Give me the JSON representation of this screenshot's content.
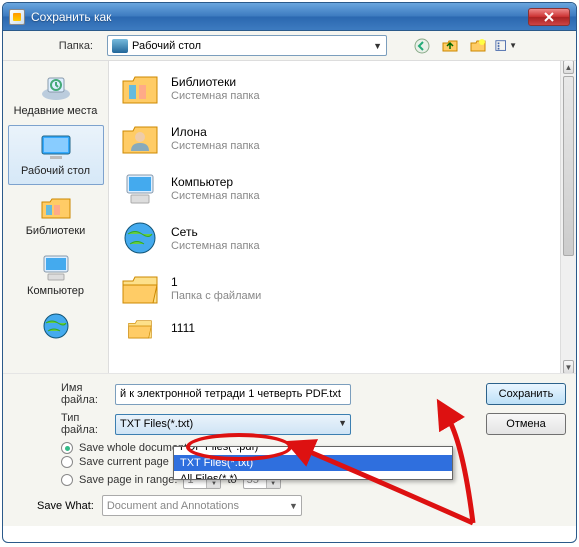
{
  "window": {
    "title": "Сохранить как"
  },
  "toolbar": {
    "folder_label": "Папка:",
    "folder_value": "Рабочий стол"
  },
  "places": [
    {
      "label": "Недавние места",
      "selected": false
    },
    {
      "label": "Рабочий стол",
      "selected": true
    },
    {
      "label": "Библиотеки",
      "selected": false
    },
    {
      "label": "Компьютер",
      "selected": false
    },
    {
      "label": "",
      "selected": false
    }
  ],
  "files": [
    {
      "name": "Библиотеки",
      "type": "Системная папка"
    },
    {
      "name": "Илона",
      "type": "Системная папка"
    },
    {
      "name": "Компьютер",
      "type": "Системная папка"
    },
    {
      "name": "Сеть",
      "type": "Системная папка"
    },
    {
      "name": "1",
      "type": "Папка с файлами"
    },
    {
      "name": "1111",
      "type": ""
    }
  ],
  "form": {
    "filename_label": "Имя файла:",
    "filename_value": "й к электронной тетради 1 четверть PDF.txt",
    "filetype_label": "Тип файла:",
    "filetype_value": "TXT Files(*.txt)",
    "save_label": "Сохранить",
    "cancel_label": "Отмена"
  },
  "dropdown": {
    "item_above": "PDF Files(*.pdf)",
    "item_selected": "TXT Files(*.txt)",
    "item_below": "All Files(*.*)"
  },
  "options": {
    "whole_doc": "Save whole document",
    "current_page": "Save current page",
    "range": "Save page in range:",
    "range_from": "1",
    "range_to_label": "to",
    "range_to": "55",
    "save_what_label": "Save What:",
    "save_what_value": "Document and Annotations"
  }
}
